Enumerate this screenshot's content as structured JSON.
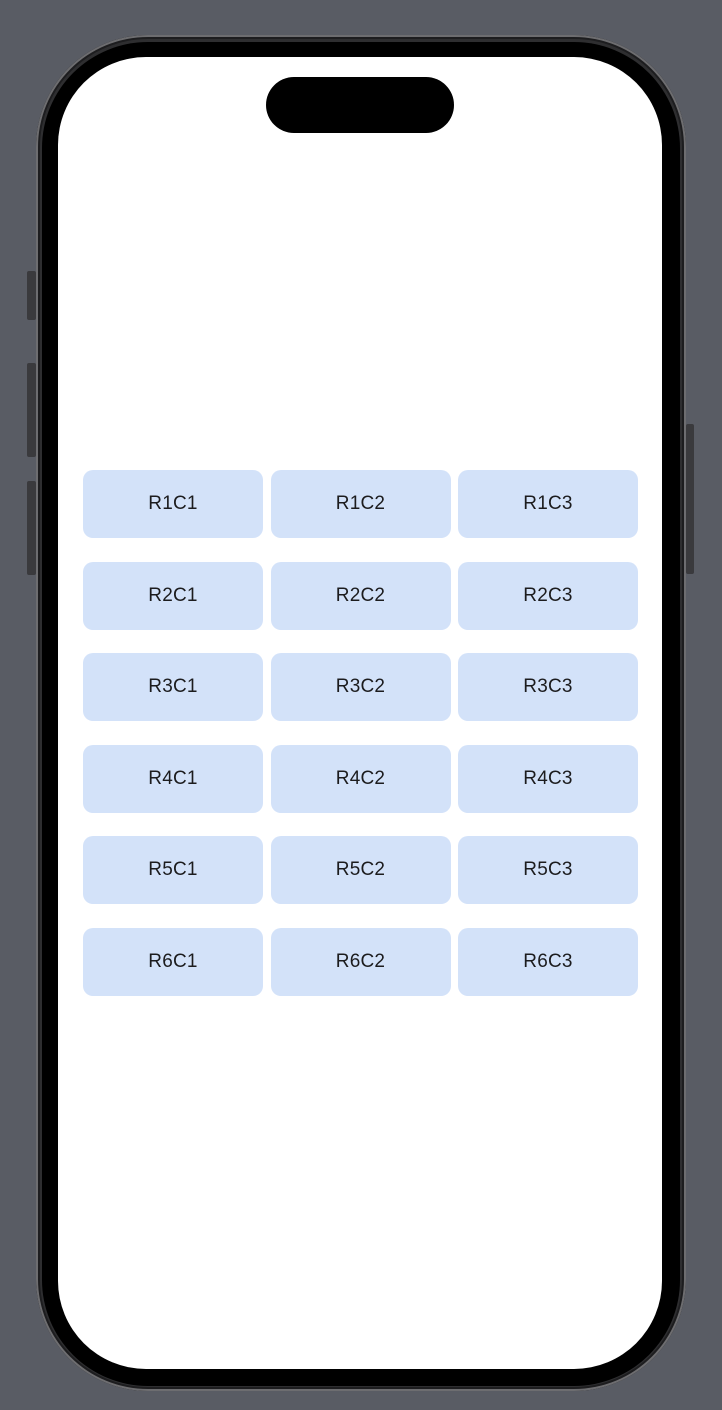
{
  "device": {
    "frame_color": "#2e2e30",
    "screen_background": "#ffffff",
    "outer_background": "#595c64"
  },
  "grid": {
    "cell_color": "#d3e2f9",
    "rows": [
      [
        "R1C1",
        "R1C2",
        "R1C3"
      ],
      [
        "R2C1",
        "R2C2",
        "R2C3"
      ],
      [
        "R3C1",
        "R3C2",
        "R3C3"
      ],
      [
        "R4C1",
        "R4C2",
        "R4C3"
      ],
      [
        "R5C1",
        "R5C2",
        "R5C3"
      ],
      [
        "R6C1",
        "R6C2",
        "R6C3"
      ]
    ]
  }
}
